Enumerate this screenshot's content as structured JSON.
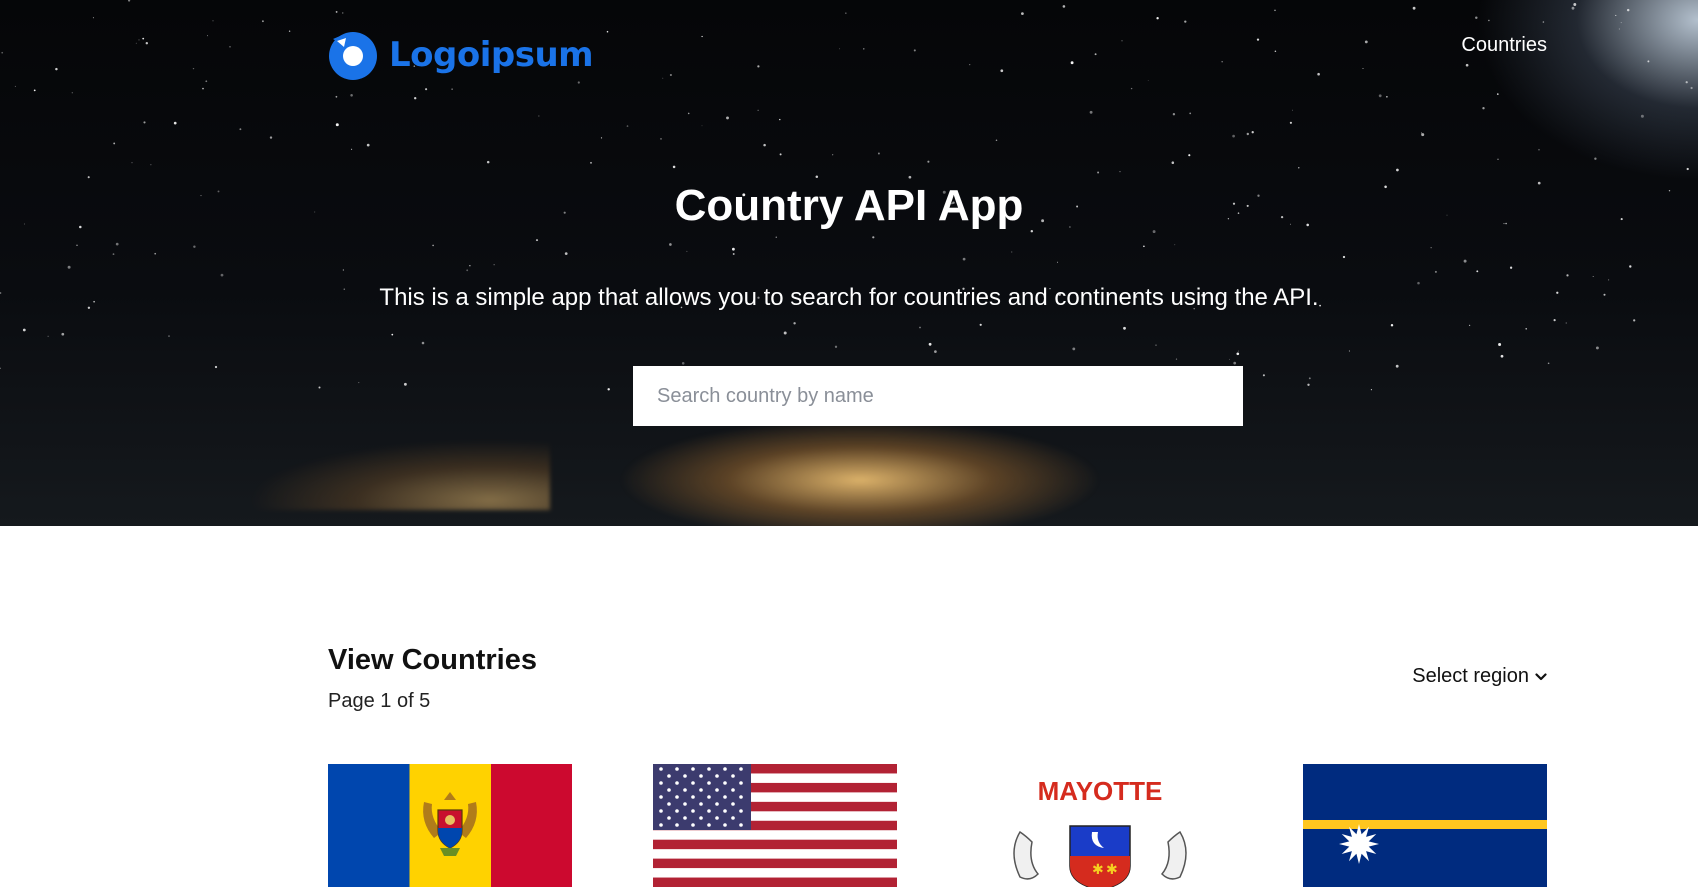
{
  "nav": {
    "logo_text": "Logoipsum",
    "links": [
      {
        "label": "Countries"
      }
    ]
  },
  "hero": {
    "title": "Country API App",
    "subtitle": "This is a simple app that allows you to search for countries and continents using the API.",
    "search_placeholder": "Search country by name",
    "search_value": ""
  },
  "countries_section": {
    "title": "View Countries",
    "page_info": "Page 1 of 5",
    "region_select": {
      "selected_label": "Select region"
    },
    "flags": [
      {
        "icon": "moldova-flag-icon"
      },
      {
        "icon": "united-states-flag-icon"
      },
      {
        "icon": "mayotte-flag-icon",
        "caption": "MAYOTTE"
      },
      {
        "icon": "nauru-flag-icon"
      }
    ]
  },
  "colors": {
    "brand_blue": "#1a73e8",
    "hero_text": "#ffffff"
  }
}
